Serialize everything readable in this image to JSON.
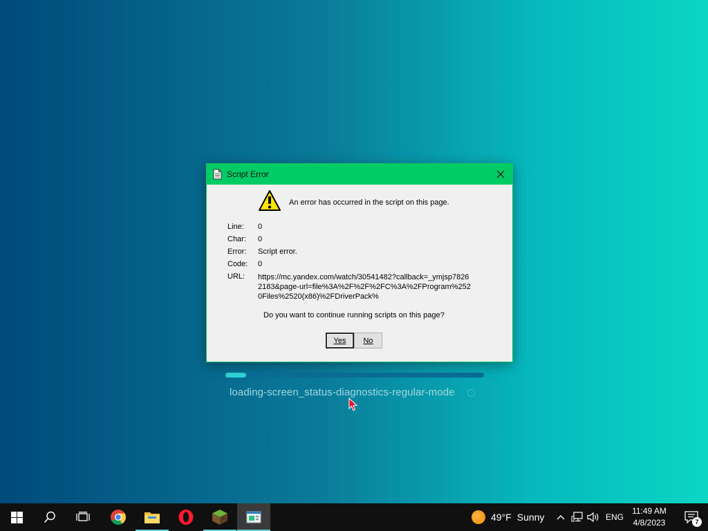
{
  "loading": {
    "status_text": "loading-screen_status-diagnostics-regular-mode",
    "progress_fraction": 0.08
  },
  "dialog": {
    "title": "Script Error",
    "headline": "An error has occurred in the script on this page.",
    "fields": [
      {
        "label": "Line:",
        "value": "0"
      },
      {
        "label": "Char:",
        "value": "0"
      },
      {
        "label": "Error:",
        "value": "Script error."
      },
      {
        "label": "Code:",
        "value": "0"
      },
      {
        "label": "URL:",
        "value": "https://mc.yandex.com/watch/30541482?callback=_ymjsp78262183&page-url=file%3A%2F%2F%2FC%3A%2FProgram%2520Files%2520(x86)%2FDriverPack%"
      }
    ],
    "question": "Do you want to continue running scripts on this page?",
    "yes_label": "Yes",
    "no_label": "No"
  },
  "taskbar": {
    "apps": [
      "start-icon",
      "search-icon",
      "task-view-icon",
      "chrome-icon",
      "file-explorer-icon",
      "opera-icon",
      "minecraft-icon",
      "driverpack-icon"
    ],
    "weather": {
      "temp": "49°F",
      "condition": "Sunny"
    },
    "language": "ENG",
    "time": "11:49 AM",
    "date": "4/8/2023",
    "notification_count": "7"
  },
  "colors": {
    "titlebar": "#00cc66",
    "accent": "#2ed3d6"
  }
}
